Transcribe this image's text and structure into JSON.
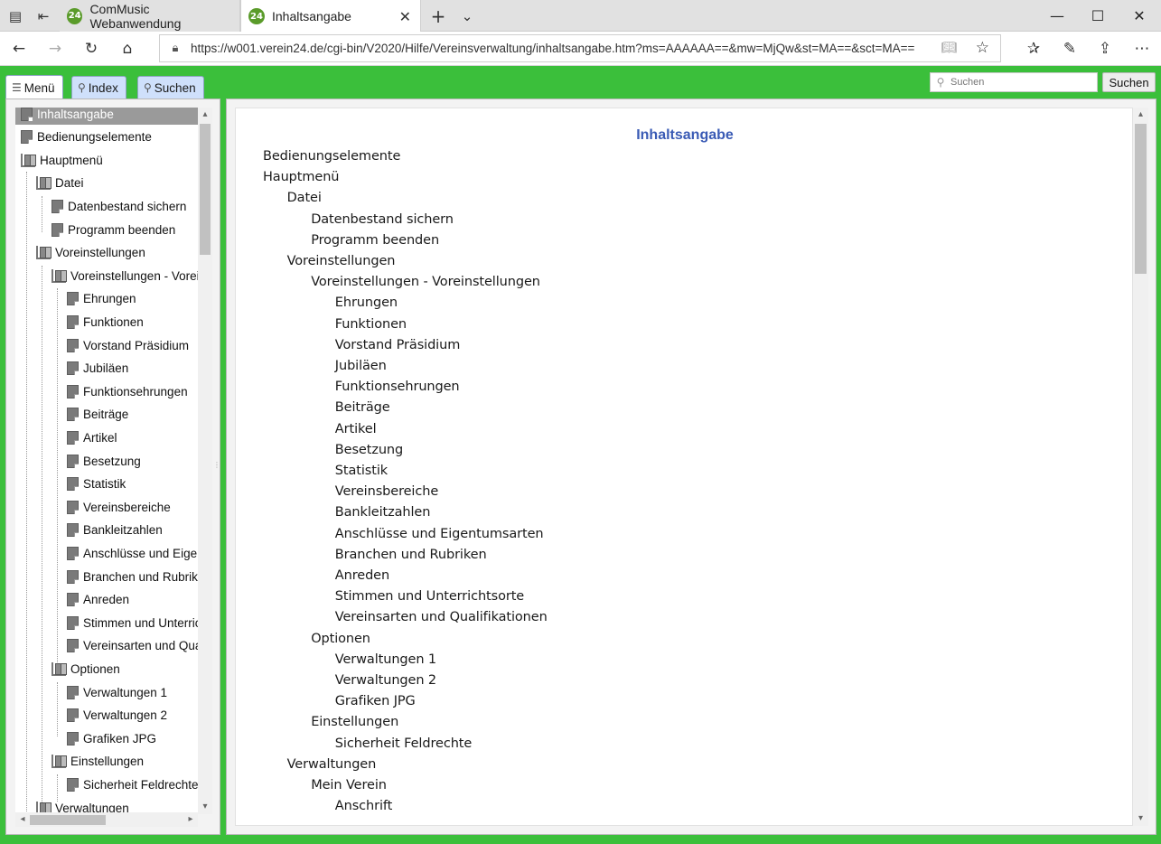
{
  "browser": {
    "tabs": [
      {
        "label": "ComMusic Webanwendung",
        "favicon": "24"
      },
      {
        "label": "Inhaltsangabe",
        "favicon": "24"
      }
    ],
    "url": "https://w001.verein24.de/cgi-bin/V2020/Hilfe/Vereinsverwaltung/inhaltsangabe.htm?ms=AAAAAA==&mw=MjQw&st=MA==&sct=MA==",
    "icons": {
      "tab_actions": "tab-actions-icon",
      "set_aside": "set-aside-tabs-icon",
      "new_tab": "new-tab-icon",
      "tab_list": "chevron-down-icon",
      "minimize": "minimize-icon",
      "maximize": "maximize-icon",
      "close": "close-icon"
    }
  },
  "app": {
    "accent_color": "#3bbf3b",
    "title_color": "#3a5bb5",
    "nav_tabs": [
      {
        "label": "Menü",
        "icon": "list-icon"
      },
      {
        "label": "Index",
        "icon": "pin-icon"
      },
      {
        "label": "Suchen",
        "icon": "magnifier-icon"
      }
    ],
    "search": {
      "placeholder": "Suchen",
      "button_label": "Suchen"
    }
  },
  "tree": [
    {
      "label": "Inhaltsangabe",
      "level": 0,
      "type": "page",
      "selected": true
    },
    {
      "label": "Bedienungselemente",
      "level": 0,
      "type": "page"
    },
    {
      "label": "Hauptmenü",
      "level": 0,
      "type": "book"
    },
    {
      "label": "Datei",
      "level": 1,
      "type": "book"
    },
    {
      "label": "Datenbestand sichern",
      "level": 2,
      "type": "page"
    },
    {
      "label": "Programm beenden",
      "level": 2,
      "type": "page"
    },
    {
      "label": "Voreinstellungen",
      "level": 1,
      "type": "book"
    },
    {
      "label": "Voreinstellungen - Voreins",
      "level": 2,
      "type": "book"
    },
    {
      "label": "Ehrungen",
      "level": 3,
      "type": "page"
    },
    {
      "label": "Funktionen",
      "level": 3,
      "type": "page"
    },
    {
      "label": "Vorstand Präsidium",
      "level": 3,
      "type": "page"
    },
    {
      "label": "Jubiläen",
      "level": 3,
      "type": "page"
    },
    {
      "label": "Funktionsehrungen",
      "level": 3,
      "type": "page"
    },
    {
      "label": "Beiträge",
      "level": 3,
      "type": "page"
    },
    {
      "label": "Artikel",
      "level": 3,
      "type": "page"
    },
    {
      "label": "Besetzung",
      "level": 3,
      "type": "page"
    },
    {
      "label": "Statistik",
      "level": 3,
      "type": "page"
    },
    {
      "label": "Vereinsbereiche",
      "level": 3,
      "type": "page"
    },
    {
      "label": "Bankleitzahlen",
      "level": 3,
      "type": "page"
    },
    {
      "label": "Anschlüsse und Eigen",
      "level": 3,
      "type": "page"
    },
    {
      "label": "Branchen und Rubrike",
      "level": 3,
      "type": "page"
    },
    {
      "label": "Anreden",
      "level": 3,
      "type": "page"
    },
    {
      "label": "Stimmen und Unterrich",
      "level": 3,
      "type": "page"
    },
    {
      "label": "Vereinsarten und Qual",
      "level": 3,
      "type": "page"
    },
    {
      "label": "Optionen",
      "level": 2,
      "type": "book"
    },
    {
      "label": "Verwaltungen 1",
      "level": 3,
      "type": "page"
    },
    {
      "label": "Verwaltungen 2",
      "level": 3,
      "type": "page"
    },
    {
      "label": "Grafiken JPG",
      "level": 3,
      "type": "page"
    },
    {
      "label": "Einstellungen",
      "level": 2,
      "type": "book"
    },
    {
      "label": "Sicherheit Feldrechte",
      "level": 3,
      "type": "page"
    },
    {
      "label": "Verwaltungen",
      "level": 1,
      "type": "book"
    }
  ],
  "content": {
    "title": "Inhaltsangabe",
    "toc": [
      {
        "text": "Bedienungselemente",
        "level": 0
      },
      {
        "text": "Hauptmenü",
        "level": 0
      },
      {
        "text": "Datei",
        "level": 1
      },
      {
        "text": "Datenbestand sichern",
        "level": 2
      },
      {
        "text": "Programm beenden",
        "level": 2
      },
      {
        "text": "Voreinstellungen",
        "level": 1
      },
      {
        "text": "Voreinstellungen - Voreinstellungen",
        "level": 2
      },
      {
        "text": "Ehrungen",
        "level": 3
      },
      {
        "text": "Funktionen",
        "level": 3
      },
      {
        "text": "Vorstand Präsidium",
        "level": 3
      },
      {
        "text": "Jubiläen",
        "level": 3
      },
      {
        "text": "Funktionsehrungen",
        "level": 3
      },
      {
        "text": "Beiträge",
        "level": 3
      },
      {
        "text": "Artikel",
        "level": 3
      },
      {
        "text": "Besetzung",
        "level": 3
      },
      {
        "text": "Statistik",
        "level": 3
      },
      {
        "text": "Vereinsbereiche",
        "level": 3
      },
      {
        "text": "Bankleitzahlen",
        "level": 3
      },
      {
        "text": "Anschlüsse und Eigentumsarten",
        "level": 3
      },
      {
        "text": "Branchen und Rubriken",
        "level": 3
      },
      {
        "text": "Anreden",
        "level": 3
      },
      {
        "text": "Stimmen und Unterrichtsorte",
        "level": 3
      },
      {
        "text": "Vereinsarten und Qualifikationen",
        "level": 3
      },
      {
        "text": "Optionen",
        "level": 2
      },
      {
        "text": "Verwaltungen 1",
        "level": 3
      },
      {
        "text": "Verwaltungen 2",
        "level": 3
      },
      {
        "text": "Grafiken JPG",
        "level": 3
      },
      {
        "text": "Einstellungen",
        "level": 2
      },
      {
        "text": "Sicherheit Feldrechte",
        "level": 3
      },
      {
        "text": "Verwaltungen",
        "level": 1
      },
      {
        "text": "Mein Verein",
        "level": 2
      },
      {
        "text": "Anschrift",
        "level": 3
      }
    ]
  }
}
